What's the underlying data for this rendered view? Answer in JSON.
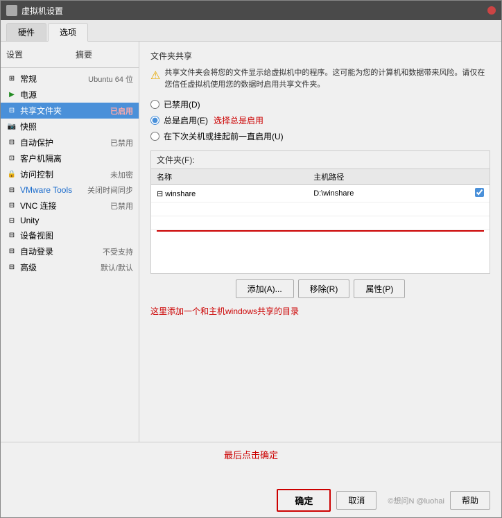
{
  "window": {
    "title": "虚拟机设置",
    "close_btn": "×"
  },
  "tabs": [
    {
      "label": "硬件",
      "active": false
    },
    {
      "label": "选项",
      "active": true
    }
  ],
  "left_panel": {
    "headers": {
      "setting": "设置",
      "summary": "摘要"
    },
    "items": [
      {
        "icon": "⊞",
        "label": "常规",
        "summary": "Ubuntu 64 位",
        "selected": false
      },
      {
        "icon": "▶",
        "label": "电源",
        "summary": "",
        "selected": false
      },
      {
        "icon": "⊟",
        "label": "共享文件夹",
        "summary": "已启用",
        "selected": true,
        "summary_highlight": true
      },
      {
        "icon": "📷",
        "label": "快照",
        "summary": "",
        "selected": false
      },
      {
        "icon": "⊟",
        "label": "自动保护",
        "summary": "已禁用",
        "selected": false
      },
      {
        "icon": "⊡",
        "label": "客户机隔离",
        "summary": "",
        "selected": false
      },
      {
        "icon": "🖥",
        "label": "访问控制",
        "summary": "未加密",
        "selected": false
      },
      {
        "icon": "⊟",
        "label": "VMware Tools",
        "summary": "关闭时间同步",
        "selected": false
      },
      {
        "icon": "⊟",
        "label": "VNC 连接",
        "summary": "已禁用",
        "selected": false
      },
      {
        "icon": "⊟",
        "label": "Unity",
        "summary": "",
        "selected": false
      },
      {
        "icon": "⊟",
        "label": "设备视图",
        "summary": "",
        "selected": false
      },
      {
        "icon": "⊟",
        "label": "自动登录",
        "summary": "不受支持",
        "selected": false
      },
      {
        "icon": "⊟",
        "label": "高级",
        "summary": "默认/默认",
        "selected": false
      }
    ]
  },
  "right_panel": {
    "section_title": "文件夹共享",
    "warning_text": "共享文件夹会将您的文件显示给虚拟机中的程序。这可能为您的计算机和数据带来风险。请仅在您信任虚拟机使用您的数据时启用共享文件夹。",
    "radio_options": [
      {
        "label": "已禁用(D)",
        "value": "disabled",
        "checked": false
      },
      {
        "label": "总是启用(E)",
        "value": "always",
        "checked": true,
        "annotation": "选择总是启用"
      },
      {
        "label": "在下次关机或挂起前一直启用(U)",
        "value": "until_shutdown",
        "checked": false
      }
    ],
    "folders_label": "文件夹(F):",
    "table_headers": {
      "name": "名称",
      "host_path": "主机路径"
    },
    "folders": [
      {
        "icon": "⊟",
        "name": "winshare",
        "host_path": "D:\\winshare",
        "enabled": true
      }
    ],
    "buttons": {
      "add": "添加(A)...",
      "remove": "移除(R)",
      "properties": "属性(P)"
    },
    "annotation": "这里添加一个和主机windows共享的目录"
  },
  "bottom": {
    "annotation": "最后点击确定",
    "buttons": {
      "ok": "确定",
      "cancel": "取消",
      "help": "帮助"
    },
    "watermark": "©想问N @luohai"
  }
}
